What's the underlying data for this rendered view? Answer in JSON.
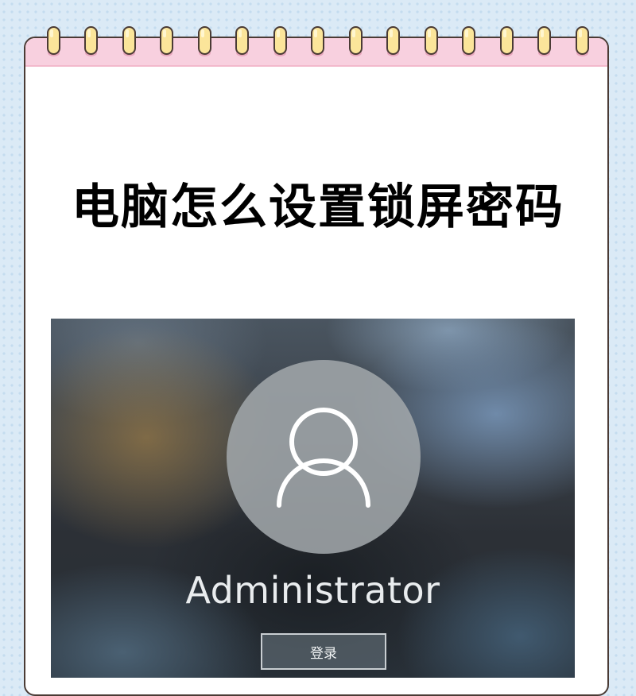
{
  "article": {
    "title": "电脑怎么设置锁屏密码"
  },
  "lock_screen": {
    "username": "Administrator",
    "login_button_label": "登录",
    "avatar_icon": "user-icon"
  },
  "colors": {
    "page_background": "#dbeaf6",
    "card_band": "#f8d0df",
    "ring_fill": "#fbe59a",
    "card_border": "#4a3b35"
  }
}
